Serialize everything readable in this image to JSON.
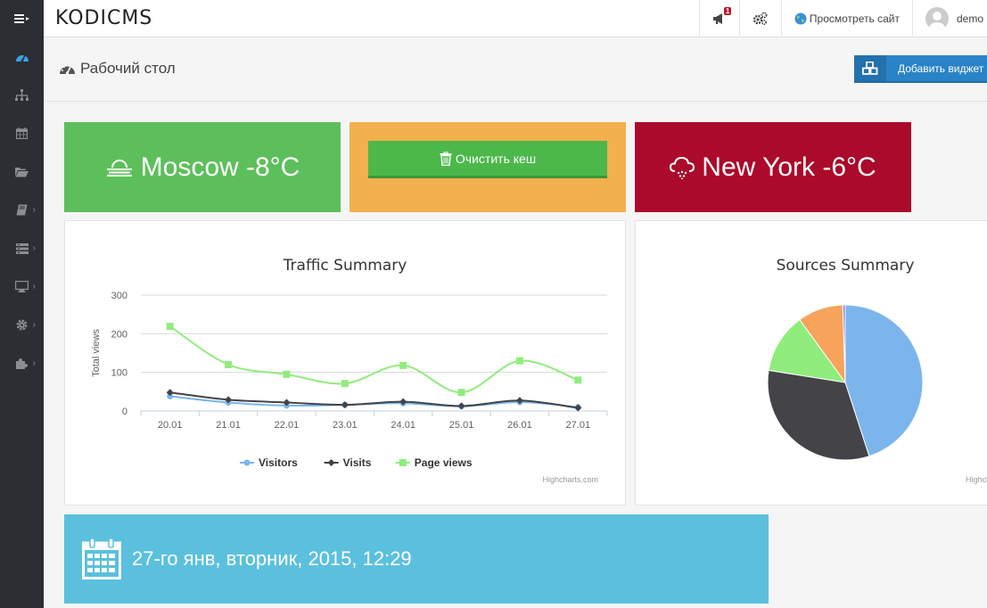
{
  "app": {
    "brand": "KODICMS"
  },
  "topbar": {
    "notifications_count": "1",
    "view_site_label": "Просмотреть сайт",
    "user_name": "demo"
  },
  "sidebar": {
    "items": [
      {
        "icon": "dashboard-icon",
        "active": true,
        "has_children": false
      },
      {
        "icon": "sitemap-icon",
        "has_children": false
      },
      {
        "icon": "calendar-icon",
        "has_children": false
      },
      {
        "icon": "folder-open-icon",
        "has_children": false
      },
      {
        "icon": "book-icon",
        "has_children": true
      },
      {
        "icon": "list-icon",
        "has_children": true
      },
      {
        "icon": "desktop-icon",
        "has_children": true
      },
      {
        "icon": "gear-icon",
        "has_children": true
      },
      {
        "icon": "puzzle-icon",
        "has_children": true
      }
    ]
  },
  "page": {
    "title": "Рабочий стол",
    "add_widget_label": "Добавить виджет"
  },
  "widgets": {
    "weather_moscow": {
      "text": "Moscow -8°C",
      "icon": "fog-icon",
      "color": "#5dbf5b"
    },
    "cache": {
      "button_label": "Очистить кеш",
      "icon": "trash-icon",
      "color": "#f2b04f"
    },
    "weather_ny": {
      "text": "New York -6°C",
      "icon": "cloud-snow-icon",
      "color": "#ab0a2a"
    },
    "date": {
      "text": "27-го янв, вторник, 2015, 12:29",
      "icon": "calendar-icon",
      "color": "#5bc0de"
    }
  },
  "chart_data": [
    {
      "type": "line",
      "title": "Traffic Summary",
      "ylabel": "Total views",
      "xlabel": "",
      "ylim": [
        0,
        300
      ],
      "yticks": [
        0,
        100,
        200,
        300
      ],
      "categories": [
        "20.01",
        "21.01",
        "22.01",
        "23.01",
        "24.01",
        "25.01",
        "26.01",
        "27.01"
      ],
      "series": [
        {
          "name": "Visitors",
          "color": "#7cb5ec",
          "marker": "circle",
          "values": [
            38,
            22,
            14,
            16,
            20,
            12,
            23,
            10
          ]
        },
        {
          "name": "Visits",
          "color": "#434348",
          "marker": "diamond",
          "values": [
            48,
            29,
            22,
            16,
            24,
            13,
            27,
            8
          ]
        },
        {
          "name": "Page views",
          "color": "#90ed7d",
          "marker": "square",
          "values": [
            219,
            120,
            95,
            71,
            118,
            48,
            130,
            80
          ]
        }
      ],
      "legend": "bottom-center",
      "grid": true,
      "credits": "Highcharts.com"
    },
    {
      "type": "pie",
      "title": "Sources Summary",
      "slices": [
        {
          "value": 45.0,
          "color": "#7cb5ec"
        },
        {
          "value": 32.5,
          "color": "#434348"
        },
        {
          "value": 12.5,
          "color": "#90ed7d"
        },
        {
          "value": 9.5,
          "color": "#f7a35c"
        },
        {
          "value": 0.5,
          "color": "#8085e9"
        }
      ],
      "credits": "Highcharts.com"
    }
  ]
}
